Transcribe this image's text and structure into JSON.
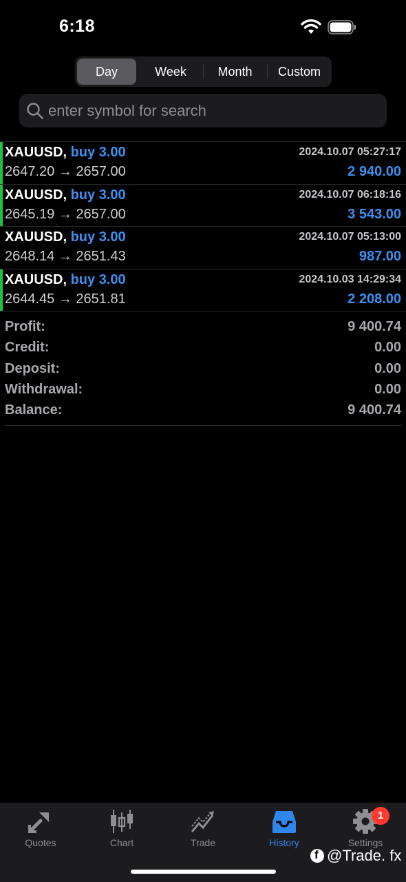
{
  "status": {
    "time": "6:18",
    "wifi_icon": "wifi-icon",
    "battery_icon": "battery-icon"
  },
  "period_tabs": [
    "Day",
    "Week",
    "Month",
    "Custom"
  ],
  "period_selected": "Day",
  "search": {
    "placeholder": "enter symbol for search",
    "value": "",
    "icon": "search-icon"
  },
  "deals": [
    {
      "symbol": "XAUUSD,",
      "type": "buy 3.00",
      "price_open": "2647.20",
      "arrow": "→",
      "price_close": "2657.00",
      "time": "2024.10.07 05:27:17",
      "profit": "2 940.00",
      "bar_color": "#1ec23a"
    },
    {
      "symbol": "XAUUSD,",
      "type": "buy 3.00",
      "price_open": "2645.19",
      "arrow": "→",
      "price_close": "2657.00",
      "time": "2024.10.07 06:18:16",
      "profit": "3 543.00",
      "bar_color": "#1ec23a"
    },
    {
      "symbol": "XAUUSD,",
      "type": "buy 3.00",
      "price_open": "2648.14",
      "arrow": "→",
      "price_close": "2651.43",
      "time": "2024.10.07 05:13:00",
      "profit": "987.00",
      "bar_color": ""
    },
    {
      "symbol": "XAUUSD,",
      "type": "buy 3.00",
      "price_open": "2644.45",
      "arrow": "→",
      "price_close": "2651.81",
      "time": "2024.10.03 14:29:34",
      "profit": "2 208.00",
      "bar_color": "#1ec23a"
    }
  ],
  "summary": [
    {
      "label": "Profit:",
      "value": "9 400.74"
    },
    {
      "label": "Credit:",
      "value": "0.00"
    },
    {
      "label": "Deposit:",
      "value": "0.00"
    },
    {
      "label": "Withdrawal:",
      "value": "0.00"
    },
    {
      "label": "Balance:",
      "value": "9 400.74"
    }
  ],
  "tab_bar": {
    "tabs": [
      {
        "label": "Quotes",
        "icon": "quotes-icon"
      },
      {
        "label": "Chart",
        "icon": "chart-icon"
      },
      {
        "label": "Trade",
        "icon": "trade-icon"
      },
      {
        "label": "History",
        "icon": "history-icon"
      },
      {
        "label": "Settings",
        "icon": "settings-icon"
      }
    ],
    "active": "History",
    "settings_badge": "1"
  },
  "watermark": "@Trade. fx",
  "colors": {
    "accent_blue": "#3d8ff0",
    "tab_active": "#2f86eb",
    "buy_bar": "#1ec23a",
    "badge_red": "#ff3b30"
  }
}
